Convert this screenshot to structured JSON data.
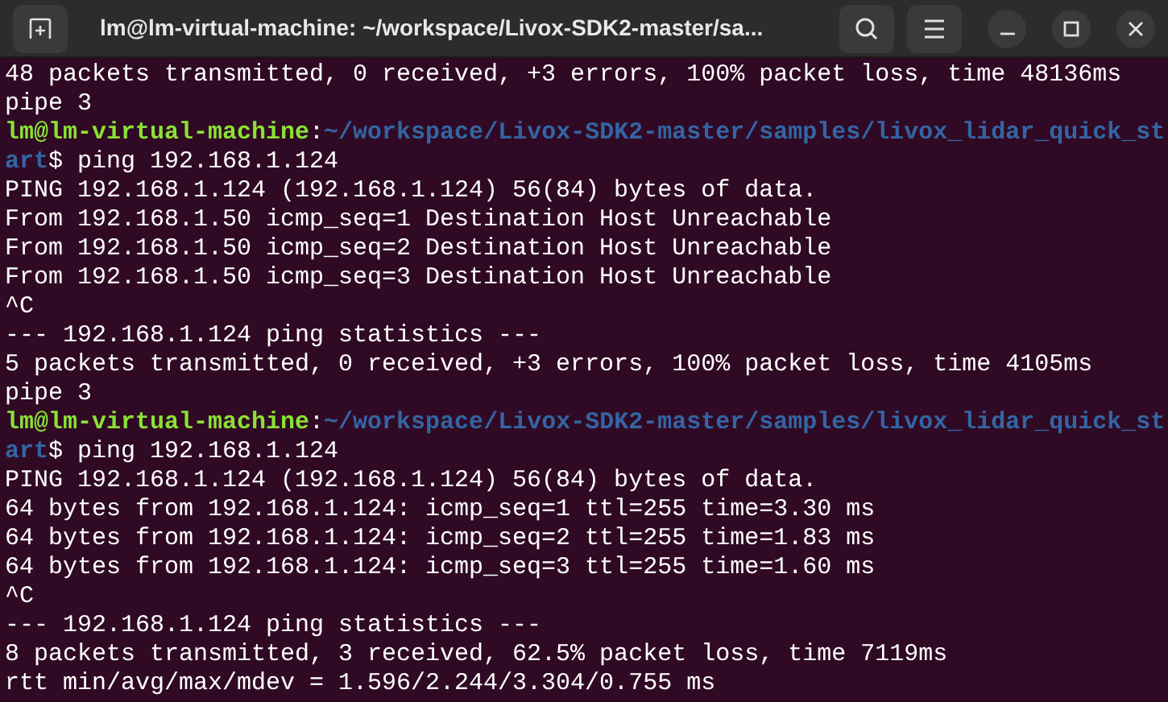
{
  "window": {
    "title": "lm@lm-virtual-machine: ~/workspace/Livox-SDK2-master/sa..."
  },
  "lines": [
    {
      "kind": "output",
      "text": "48 packets transmitted, 0 received, +3 errors, 100% packet loss, time 48136ms"
    },
    {
      "kind": "output",
      "text": "pipe 3"
    },
    {
      "kind": "prompt",
      "user": "lm@lm-virtual-machine",
      "separator": ":",
      "path": "~/workspace/Livox-SDK2-master/samples/livox_lidar_quick_st"
    },
    {
      "kind": "continuation",
      "path": "art",
      "sign": "$",
      "command": "ping 192.168.1.124"
    },
    {
      "kind": "output",
      "text": "PING 192.168.1.124 (192.168.1.124) 56(84) bytes of data."
    },
    {
      "kind": "output",
      "text": "From 192.168.1.50 icmp_seq=1 Destination Host Unreachable"
    },
    {
      "kind": "output",
      "text": "From 192.168.1.50 icmp_seq=2 Destination Host Unreachable"
    },
    {
      "kind": "output",
      "text": "From 192.168.1.50 icmp_seq=3 Destination Host Unreachable"
    },
    {
      "kind": "output",
      "text": "^C"
    },
    {
      "kind": "output",
      "text": "--- 192.168.1.124 ping statistics ---"
    },
    {
      "kind": "output",
      "text": "5 packets transmitted, 0 received, +3 errors, 100% packet loss, time 4105ms"
    },
    {
      "kind": "output",
      "text": "pipe 3"
    },
    {
      "kind": "prompt",
      "user": "lm@lm-virtual-machine",
      "separator": ":",
      "path": "~/workspace/Livox-SDK2-master/samples/livox_lidar_quick_st"
    },
    {
      "kind": "continuation",
      "path": "art",
      "sign": "$",
      "command": "ping 192.168.1.124"
    },
    {
      "kind": "output",
      "text": "PING 192.168.1.124 (192.168.1.124) 56(84) bytes of data."
    },
    {
      "kind": "output",
      "text": "64 bytes from 192.168.1.124: icmp_seq=1 ttl=255 time=3.30 ms"
    },
    {
      "kind": "output",
      "text": "64 bytes from 192.168.1.124: icmp_seq=2 ttl=255 time=1.83 ms"
    },
    {
      "kind": "output",
      "text": "64 bytes from 192.168.1.124: icmp_seq=3 ttl=255 time=1.60 ms"
    },
    {
      "kind": "output",
      "text": "^C"
    },
    {
      "kind": "output",
      "text": "--- 192.168.1.124 ping statistics ---"
    },
    {
      "kind": "output",
      "text": "8 packets transmitted, 3 received, 62.5% packet loss, time 7119ms"
    },
    {
      "kind": "output",
      "text": "rtt min/avg/max/mdev = 1.596/2.244/3.304/0.755 ms"
    }
  ]
}
